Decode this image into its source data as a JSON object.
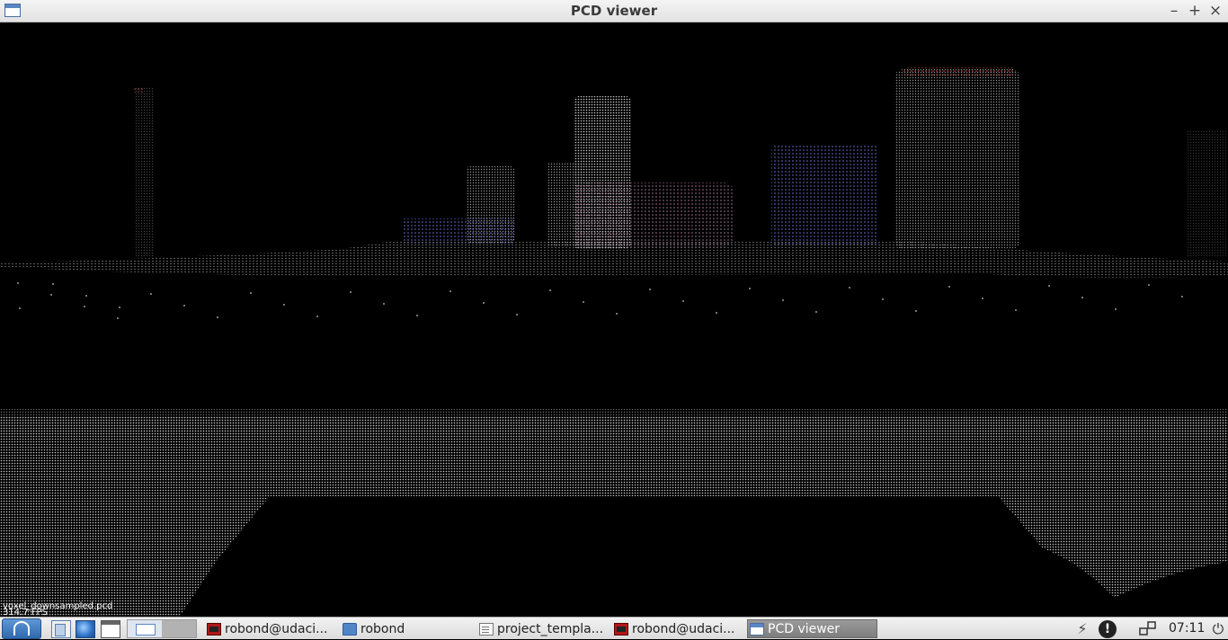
{
  "window": {
    "title": "PCD viewer",
    "controls": {
      "minimize": "–",
      "maximize": "+",
      "close": "×"
    }
  },
  "viewer": {
    "overlay_file": "voxel_downsampled.pcd",
    "overlay_fps": "314.7 FPS",
    "background": "#000000"
  },
  "taskbar": {
    "quick_launch": [
      {
        "icon": "file-manager-icon"
      },
      {
        "icon": "web-browser-icon"
      },
      {
        "icon": "show-desktop-icon"
      }
    ],
    "tasks": [
      {
        "label": "robond@udaci...",
        "icon": "terminal-icon",
        "active": false
      },
      {
        "label": "robond",
        "icon": "folder-icon",
        "active": false
      },
      {
        "label": "project_templa...",
        "icon": "text-document-icon",
        "active": false
      },
      {
        "label": "robond@udaci...",
        "icon": "terminal-icon",
        "active": false
      },
      {
        "label": "PCD viewer",
        "icon": "window-icon",
        "active": true
      }
    ],
    "tray": {
      "power": "⚡",
      "alert": "!",
      "network": "network-icon",
      "clock": "07:11",
      "shutdown": "⏻"
    }
  }
}
